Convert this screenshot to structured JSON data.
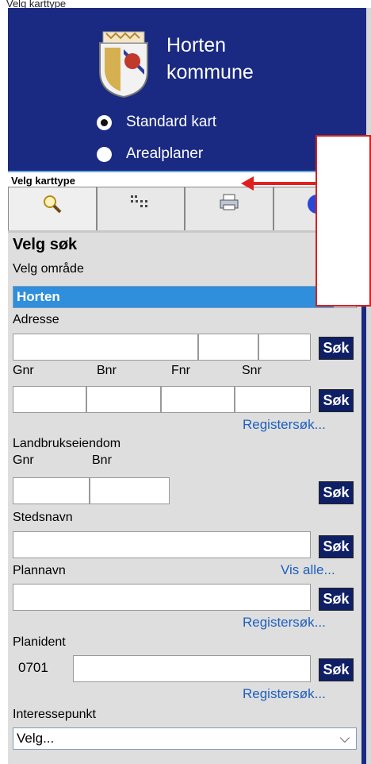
{
  "top_caption": "Velg karttype",
  "brand": {
    "line1": "Horten",
    "line2": "kommune"
  },
  "map_options": [
    {
      "label": "Standard kart",
      "checked": true
    },
    {
      "label": "Arealplaner",
      "checked": false
    }
  ],
  "maptype_bar_label": "Velg karttype",
  "tabs": [
    {
      "icon": "magnifier-icon"
    },
    {
      "icon": "layers-grid-icon"
    },
    {
      "icon": "printer-icon"
    },
    {
      "icon": "info-icon"
    }
  ],
  "search": {
    "heading": "Velg søk",
    "area_label": "Velg område",
    "area_value": "Horten",
    "address_label": "Adresse",
    "search_button": "Søk",
    "gnr": "Gnr",
    "bnr": "Bnr",
    "fnr": "Fnr",
    "snr": "Snr",
    "register_link": "Registersøk...",
    "farm_label": "Landbrukseiendom",
    "place_label": "Stedsnavn",
    "plan_name_label": "Plannavn",
    "show_all_link": "Vis alle...",
    "plan_id_label": "Planident",
    "plan_id_prefix": "0701",
    "poi_label": "Interessepunkt",
    "poi_value": "Velg..."
  },
  "colors": {
    "header": "#1a2a82",
    "button": "#0f1f66",
    "link": "#1e5fbf",
    "selected": "#2f8fdc",
    "annotation": "#e02020"
  }
}
